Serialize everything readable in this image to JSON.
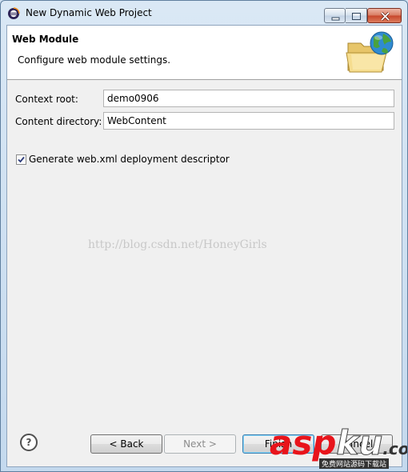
{
  "window": {
    "title": "New Dynamic Web Project",
    "icon": "eclipse-icon"
  },
  "header": {
    "title": "Web Module",
    "description": "Configure web module settings.",
    "icon": "web-folder-globe-icon"
  },
  "form": {
    "context_root": {
      "label": "Context root:",
      "value": "demo0906"
    },
    "content_directory": {
      "label": "Content directory:",
      "value": "WebContent"
    },
    "generate_web_xml": {
      "label": "Generate web.xml deployment descriptor",
      "checked": true
    }
  },
  "watermark": "http://blog.csdn.net/HoneyGirls",
  "buttons": {
    "help": "?",
    "back": "< Back",
    "next": "Next >",
    "finish": "Finish",
    "cancel": "Cancel"
  },
  "overlay_logo": {
    "asp": "asp",
    "ku": "ku",
    "com": ".com",
    "subtitle": "免费网站源码下载站"
  },
  "colors": {
    "header_bg": "#ffffff",
    "client_bg": "#f0f0f0",
    "logo_red": "#e8141b",
    "close_button": "#c7452a"
  }
}
